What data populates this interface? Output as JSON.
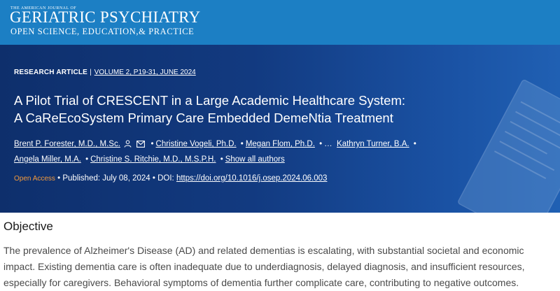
{
  "journal": {
    "small_line": "THE AMERICAN JOURNAL OF",
    "name": "GERIATRIC PSYCHIATRY",
    "tagline": "OPEN SCIENCE, EDUCATION,& PRACTICE"
  },
  "article": {
    "type": "RESEARCH ARTICLE",
    "separator": "|",
    "volume": "VOLUME 2, P19-31, JUNE 2024",
    "title_line1": "A Pilot Trial of CRESCENT in a Large Academic Healthcare System:",
    "title_line2": "A CaReEcoSystem Primary Care Embedded DemeNtia Treatment",
    "authors": [
      "Brent P. Forester, M.D., M.Sc.",
      "Christine Vogeli, Ph.D.",
      "Megan Flom, Ph.D.",
      "Kathryn Turner, B.A.",
      "Angela Miller, M.A.",
      "Christine S. Ritchie, M.D., M.S.P.H."
    ],
    "ellipsis": "…",
    "show_all": "Show all authors",
    "open_access": "Open Access",
    "published": "Published: July 08, 2024",
    "doi_label": "DOI:",
    "doi": "https://doi.org/10.1016/j.osep.2024.06.003"
  },
  "section": {
    "heading": "Objective",
    "text": "The prevalence of Alzheimer's Disease (AD) and related dementias is escalating, with substantial societal and economic impact. Existing dementia care is often inadequate due to underdiagnosis, delayed diagnosis, and insufficient resources, especially for caregivers. Behavioral symptoms of dementia further complicate care, contributing to negative outcomes."
  },
  "icons": [
    "person-icon",
    "envelope-icon"
  ],
  "colors": {
    "journal_bar": "#1c7fc4",
    "hero": "#123a80",
    "open_access": "#f39a3c"
  }
}
